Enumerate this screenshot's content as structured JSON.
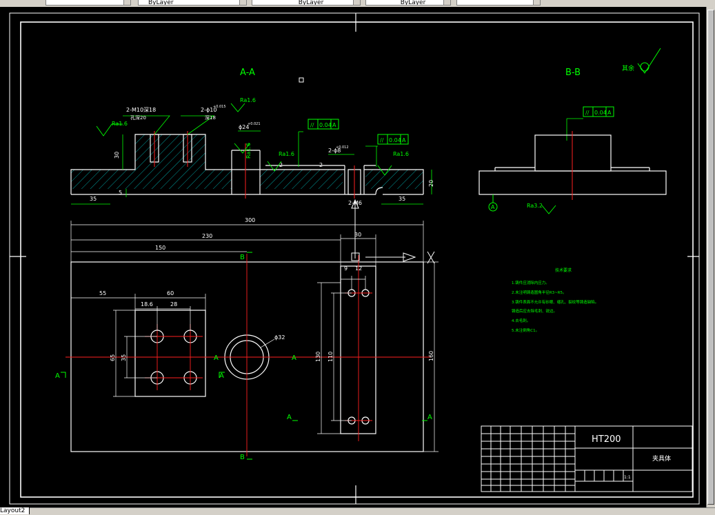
{
  "toolbar": {
    "layer_combo": "",
    "color_combo": "ByLayer",
    "linetype_combo": "ByLayer",
    "lineweight_combo": "ByLayer",
    "plotstyle_combo": ""
  },
  "layout_tab": "Layout2",
  "drawing": {
    "section_aa_title": "A-A",
    "section_bb_title": "B-B",
    "other_finish_label": "其余",
    "dims_top": {
      "d35_left": "35",
      "d35_right": "35",
      "d30": "30",
      "d20": "20",
      "d5": "5",
      "d2a": "2",
      "d2b": "2",
      "holes_label": "2-M10深18",
      "holes_sub": "孔深20",
      "pin_label": "2-ϕ10",
      "pin_tol": "+0.015",
      "pin_sub": "深18",
      "bore_label": "ϕ24",
      "bore_tol": "+0.021",
      "slot_label": "2-ϕ8",
      "slot_tol": "+0.012",
      "m6_label": "2-M6"
    },
    "roughness": {
      "ra16_a": "Ra1.6",
      "ra16_b": "Ra1.6",
      "ra16_c": "Ra1.6",
      "ra16_d": "Ra1.6",
      "ra16_e": "Ra1.6",
      "ra32": "Ra3.2"
    },
    "tolerance_frames": {
      "aa_left_sym": "//",
      "aa_left_val": "0.04",
      "aa_left_ref": "A",
      "aa_right_sym": "//",
      "aa_right_val": "0.04",
      "aa_right_ref": "A",
      "bb_sym": "//",
      "bb_val": "0.04",
      "bb_ref": "A"
    },
    "datum_label": "A",
    "plan_dims": {
      "d300": "300",
      "d230": "230",
      "d150": "150",
      "d30": "30",
      "d9": "9",
      "d12": "12",
      "d55": "55",
      "d60": "60",
      "d186": "18.6",
      "d28": "28",
      "d65": "65",
      "d35": "35",
      "d130": "130",
      "d110": "110",
      "d160": "160",
      "phi32": "ϕ32"
    },
    "section_marks": {
      "a": "A",
      "b": "B"
    },
    "tech_requirements": {
      "title": "技术要求",
      "items": [
        "1.铸件应消除内应力。",
        "2.未注明铸造圆角半径R3~R5。",
        "3.铸件表面不允许有砂眼、缩孔、裂纹等铸造缺陷。",
        "铸造后应去除毛刺、锐边。",
        "4.去毛刺。",
        "5.未注倒角C1。"
      ]
    },
    "title_block": {
      "material": "HT200",
      "part_name": "夹具体",
      "scale": "1:1"
    }
  }
}
